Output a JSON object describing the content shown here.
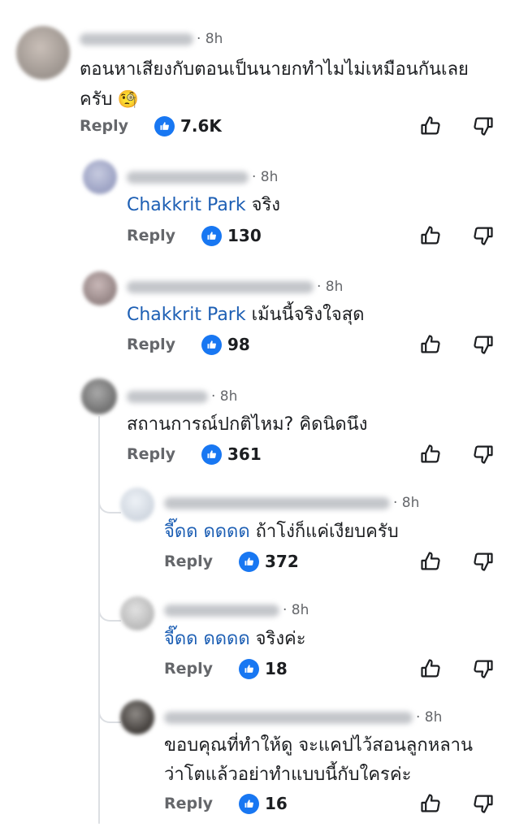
{
  "comments": [
    {
      "time": "· 8h",
      "text_lines": [
        "ตอนหาเสียงกับตอนเป็นนายกทำไมไม่เหมือนกันเลย",
        "ครับ"
      ],
      "emoji": "🧐",
      "reply_label": "Reply",
      "likes": "7.6K"
    },
    {
      "time": "· 8h",
      "mention": "Chakkrit Park",
      "text": "จริง",
      "reply_label": "Reply",
      "likes": "130"
    },
    {
      "time": "· 8h",
      "mention": "Chakkrit Park",
      "text": "เม้นนี้จริงใจสุด",
      "reply_label": "Reply",
      "likes": "98"
    },
    {
      "time": "· 8h",
      "text": "สถานการณ์ปกติไหม? คิดนิดนึง",
      "reply_label": "Reply",
      "likes": "361"
    },
    {
      "time": "· 8h",
      "mention": "จี๊ดด ดดดด",
      "text": "ถ้าโง่ก็แค่เงียบครับ",
      "reply_label": "Reply",
      "likes": "372"
    },
    {
      "time": "· 8h",
      "mention": "จี๊ดด ดดดด",
      "text": "จริงค่ะ",
      "reply_label": "Reply",
      "likes": "18"
    },
    {
      "time": "· 8h",
      "text_lines": [
        "ขอบคุณที่ทำให้ดู จะแคปไว้สอนลูกหลาน",
        "ว่าโตแล้วอย่าทำแบบนี้กับใครค่ะ"
      ],
      "reply_label": "Reply",
      "likes": "16"
    }
  ],
  "icons": {
    "like_badge": "thumbs-up-badge-icon",
    "upvote": "thumbs-up-outline-icon",
    "downvote": "thumbs-down-outline-icon"
  },
  "colors": {
    "accent": "#1877f2",
    "mention": "#1d5fb4",
    "meta": "#65676b"
  }
}
